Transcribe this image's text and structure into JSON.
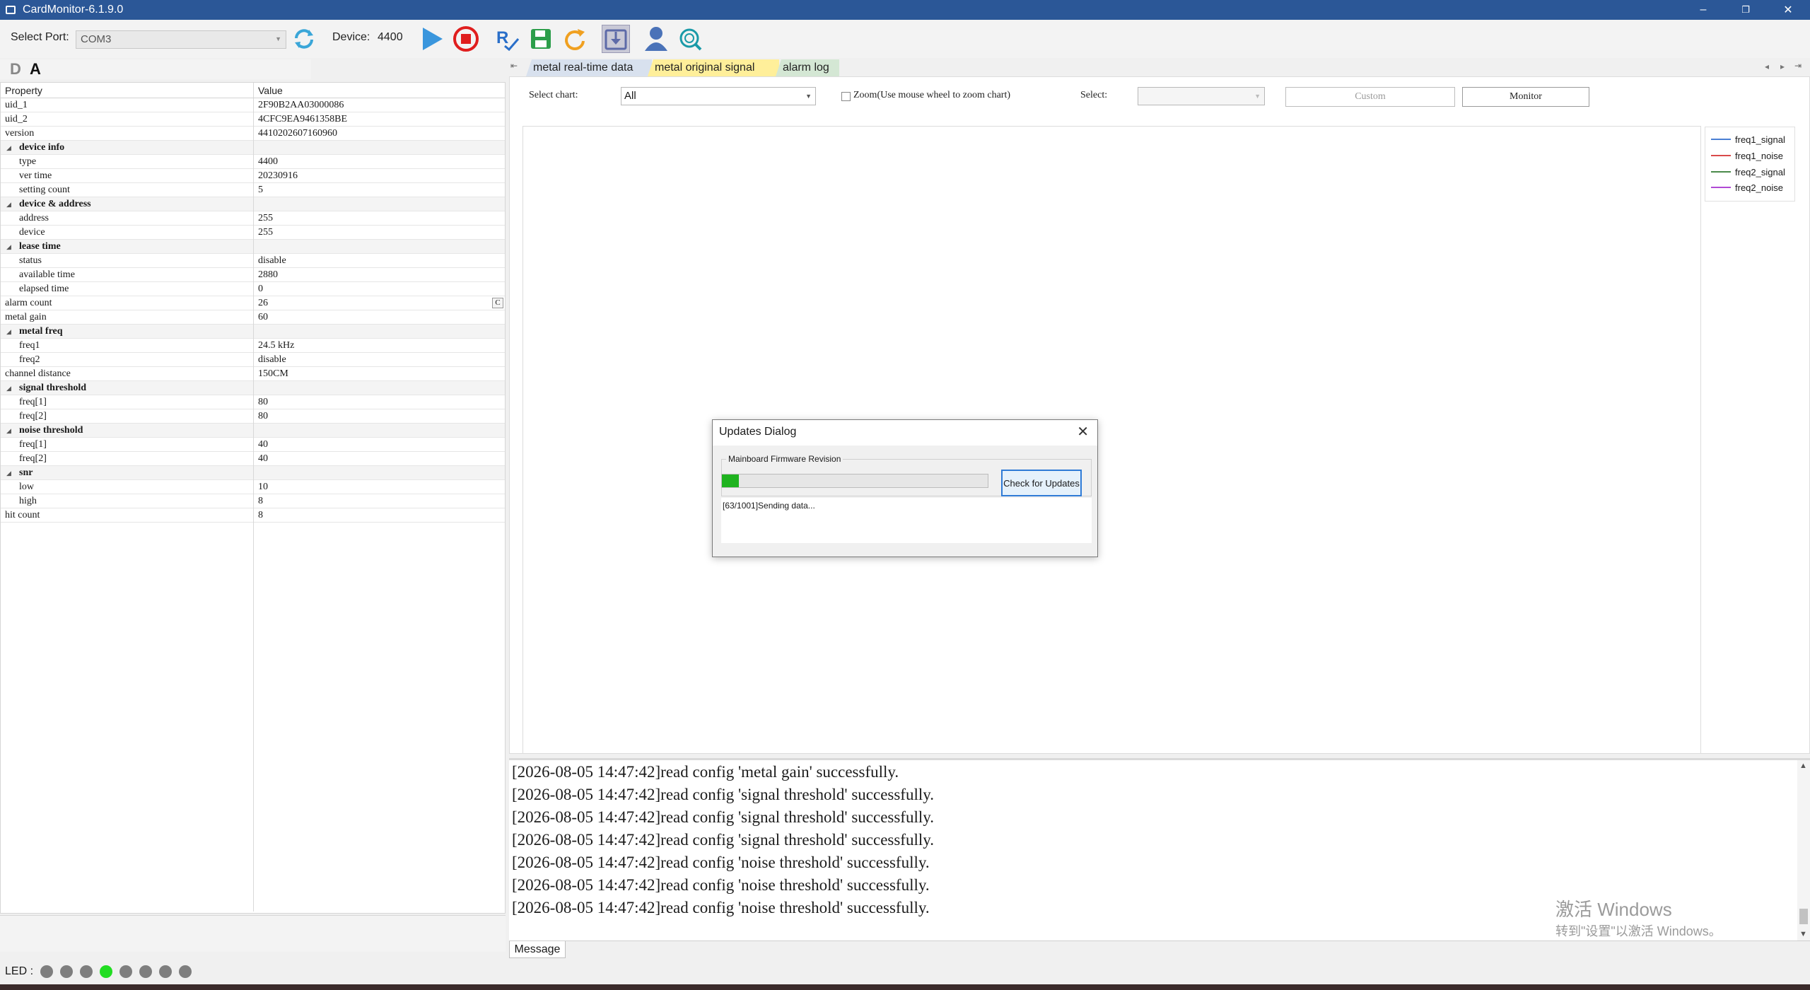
{
  "window": {
    "title": "CardMonitor-6.1.9.0",
    "minimize": "–",
    "restore": "❐",
    "close": "✕"
  },
  "toolbar": {
    "port_label": "Select Port:",
    "port_value": "COM3",
    "device_label": "Device:",
    "device_value": "4400"
  },
  "left_panel": {
    "d_label": "D",
    "a_label": "A",
    "col_property": "Property",
    "col_value": "Value",
    "rows": [
      {
        "name": "uid_1",
        "value": "2F90B2AA03000086"
      },
      {
        "name": "uid_2",
        "value": "4CFC9EA9461358BE"
      },
      {
        "name": "version",
        "value": "4410202607160960"
      },
      {
        "name": "device info",
        "value": ""
      },
      {
        "name": "type",
        "value": "4400"
      },
      {
        "name": "ver time",
        "value": "20230916"
      },
      {
        "name": "setting count",
        "value": "5"
      },
      {
        "name": "device & address",
        "value": ""
      },
      {
        "name": "address",
        "value": "255"
      },
      {
        "name": "device",
        "value": "255"
      },
      {
        "name": "lease time",
        "value": ""
      },
      {
        "name": "status",
        "value": "disable"
      },
      {
        "name": "available time",
        "value": "2880"
      },
      {
        "name": "elapsed time",
        "value": "0"
      },
      {
        "name": "alarm count",
        "value": "26",
        "button": "C"
      },
      {
        "name": "metal gain",
        "value": "60"
      },
      {
        "name": "metal freq",
        "value": ""
      },
      {
        "name": "freq1",
        "value": "24.5 kHz"
      },
      {
        "name": "freq2",
        "value": "disable"
      },
      {
        "name": "channel distance",
        "value": "150CM"
      },
      {
        "name": "signal threshold",
        "value": ""
      },
      {
        "name": "freq[1]",
        "value": "80"
      },
      {
        "name": "freq[2]",
        "value": "80"
      },
      {
        "name": "noise threshold",
        "value": ""
      },
      {
        "name": "freq[1]",
        "value": "40"
      },
      {
        "name": "freq[2]",
        "value": "40"
      },
      {
        "name": "snr",
        "value": ""
      },
      {
        "name": "low",
        "value": "10"
      },
      {
        "name": "high",
        "value": "8"
      },
      {
        "name": "hit count",
        "value": "8"
      }
    ]
  },
  "tabs": [
    "metal real-time data",
    "metal original signal",
    "alarm log"
  ],
  "chart_controls": {
    "select_chart_label": "Select chart:",
    "select_chart_value": "All",
    "zoom_label": "Zoom(Use mouse wheel to zoom chart)",
    "select_label": "Select:",
    "select_value": "",
    "custom_button": "Custom",
    "monitor_button": "Monitor"
  },
  "legend": [
    {
      "name": "freq1_signal",
      "color": "#4a7fd4"
    },
    {
      "name": "freq1_noise",
      "color": "#d94a4a"
    },
    {
      "name": "freq2_signal",
      "color": "#4a8a4a"
    },
    {
      "name": "freq2_noise",
      "color": "#b04ad4"
    }
  ],
  "log": {
    "lines": [
      "[2026-08-05 14:47:42]read config 'metal gain' successfully.",
      "[2026-08-05 14:47:42]read config 'signal threshold' successfully.",
      "[2026-08-05 14:47:42]read config 'signal threshold' successfully.",
      "[2026-08-05 14:47:42]read config 'signal threshold' successfully.",
      "[2026-08-05 14:47:42]read config 'noise threshold' successfully.",
      "[2026-08-05 14:47:42]read config 'noise threshold' successfully.",
      "[2026-08-05 14:47:42]read config 'noise threshold' successfully."
    ],
    "tab_label": "Message"
  },
  "watermark": {
    "line1": "激活 Windows",
    "line2": "转到\"设置\"以激活 Windows。"
  },
  "dialog": {
    "title": "Updates Dialog",
    "group_label": "Mainboard Firmware Revision",
    "progress_fraction": 0.063,
    "check_button": "Check for Updates",
    "status": "[63/1001]Sending data..."
  },
  "led": {
    "label": "LED :",
    "states": [
      false,
      false,
      false,
      true,
      false,
      false,
      false,
      false
    ]
  }
}
